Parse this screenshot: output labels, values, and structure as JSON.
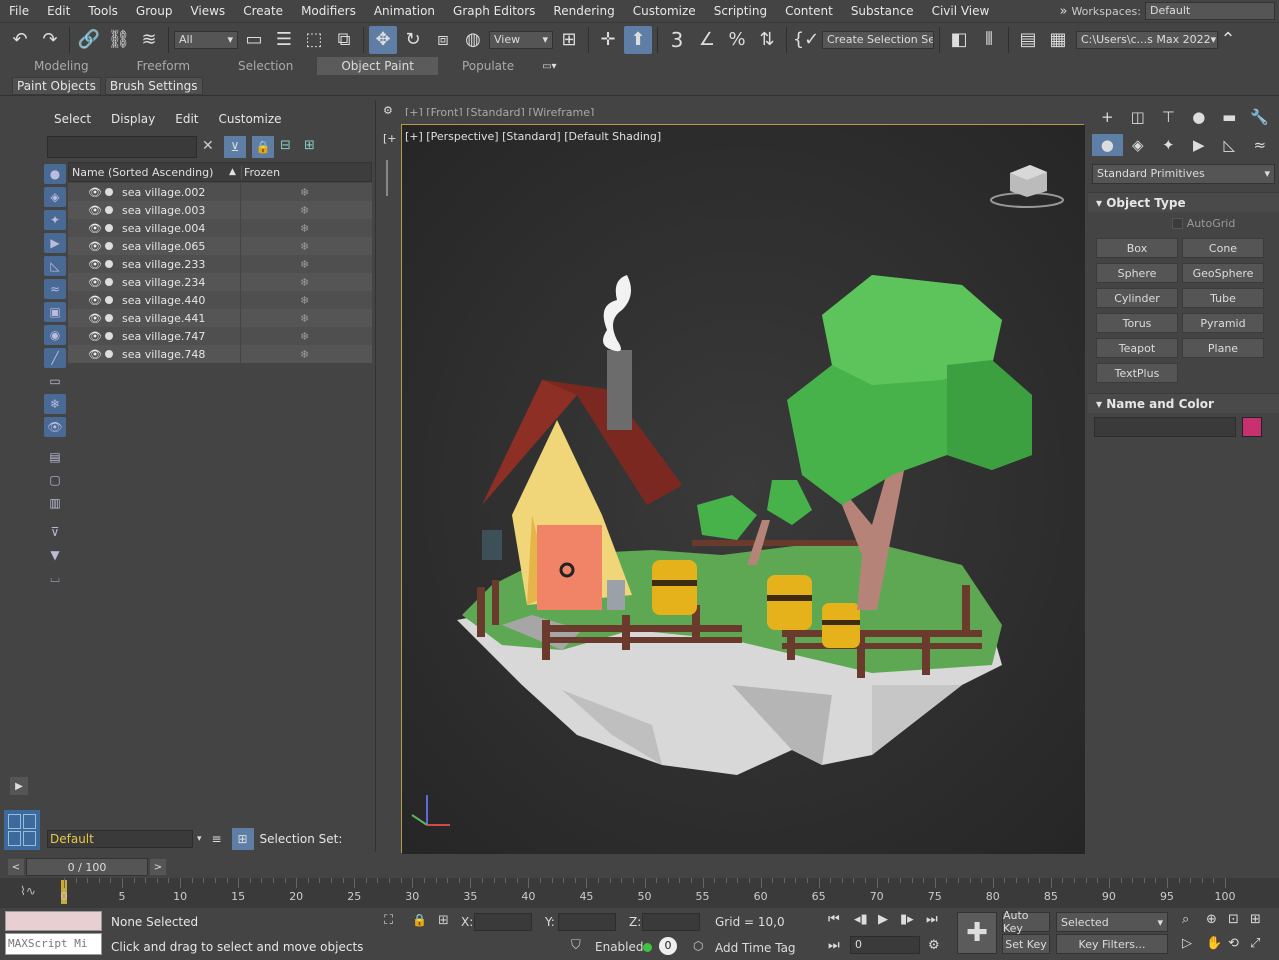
{
  "menu": [
    "File",
    "Edit",
    "Tools",
    "Group",
    "Views",
    "Create",
    "Modifiers",
    "Animation",
    "Graph Editors",
    "Rendering",
    "Customize",
    "Scripting",
    "Content",
    "Substance",
    "Civil View"
  ],
  "workspaces_label": "Workspaces:",
  "workspace_value": "Default",
  "toolbar": {
    "filter_value": "All",
    "refcoord_value": "View",
    "selection_set_value": "Create Selection Se",
    "path_value": "C:\\Users\\c...s Max 2022",
    "snap_label": "3"
  },
  "ribbon_tabs": [
    {
      "label": "Modeling",
      "selected": false
    },
    {
      "label": "Freeform",
      "selected": false
    },
    {
      "label": "Selection",
      "selected": false
    },
    {
      "label": "Object Paint",
      "selected": true
    },
    {
      "label": "Populate",
      "selected": false
    }
  ],
  "ribbon_sub": [
    "Paint Objects",
    "Brush Settings"
  ],
  "scene_explorer": {
    "menu": [
      "Select",
      "Display",
      "Edit",
      "Customize"
    ],
    "col_name": "Name (Sorted Ascending)",
    "col_frozen": "Frozen",
    "rows": [
      "sea village.002",
      "sea village.003",
      "sea village.004",
      "sea village.065",
      "sea village.233",
      "sea village.234",
      "sea village.440",
      "sea village.441",
      "sea village.747",
      "sea village.748"
    ],
    "layer_value": "Default",
    "selection_set_label": "Selection Set:"
  },
  "viewport": {
    "label": "[+] [Perspective] [Standard] [Default Shading]",
    "top_label": "[+] [Front] [Standard] [Wireframe]",
    "border_color": "#b69a4a"
  },
  "command_panel": {
    "category": "Standard Primitives",
    "object_type": "Object Type",
    "autogrid": "AutoGrid",
    "buttons": [
      "Box",
      "Cone",
      "Sphere",
      "GeoSphere",
      "Cylinder",
      "Tube",
      "Torus",
      "Pyramid",
      "Teapot",
      "Plane",
      "TextPlus"
    ],
    "name_color": "Name and Color",
    "swatch_color": "#c8316f"
  },
  "timeline": {
    "frame_display": "0 / 100",
    "ticks": [
      0,
      5,
      10,
      15,
      20,
      25,
      30,
      35,
      40,
      45,
      50,
      55,
      60,
      65,
      70,
      75,
      80,
      85,
      90,
      95,
      100
    ]
  },
  "status": {
    "maxscript": "MAXScript Mi",
    "none_selected": "None Selected",
    "prompt": "Click and drag to select and move objects",
    "x_label": "X:",
    "y_label": "Y:",
    "z_label": "Z:",
    "grid": "Grid = 10,0",
    "enabled": "Enabled:",
    "enabled_value": "0",
    "add_time_tag": "Add Time Tag",
    "auto_key": "Auto Key",
    "selected": "Selected",
    "set_key": "Set Key",
    "key_filters": "Key Filters...",
    "frame_value": "0"
  }
}
